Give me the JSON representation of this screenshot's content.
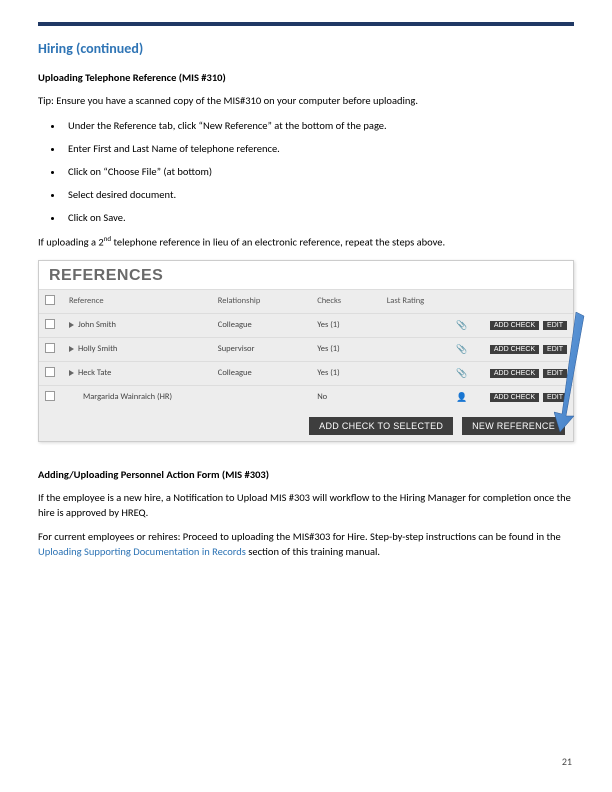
{
  "page": {
    "title": "Hiring (continued)",
    "sub1": "Uploading Telephone Reference (MIS #310)",
    "tip": "Tip: Ensure you have a scanned copy of the MIS#310 on your computer before uploading.",
    "bullets": [
      "Under the Reference tab, click “New Reference” at the bottom of the page.",
      "Enter First and Last Name of telephone reference.",
      "Click on “Choose File” (at bottom)",
      "Select desired document.",
      "Click on Save."
    ],
    "note_prefix": "If uploading a 2",
    "note_sup": "nd",
    "note_suffix": " telephone reference in lieu of an electronic reference, repeat the steps above.",
    "sub2": "Adding/Uploading Personnel Action Form (MIS #303)",
    "para2": "If the employee is a new hire, a Notification to Upload MIS #303 will workflow to the Hiring Manager for completion once the hire is approved by HREQ.",
    "para3a": "For current employees or rehires: Proceed to uploading the MIS#303 for Hire. Step-by-step instructions can be found in the ",
    "para3link": "Uploading Supporting Documentation in Records",
    "para3b": " section of this training manual.",
    "page_number": "21"
  },
  "refs": {
    "title": "REFERENCES",
    "headers": {
      "ref": "Reference",
      "rel": "Relationship",
      "checks": "Checks",
      "last": "Last Rating"
    },
    "rows": [
      {
        "name": "John Smith",
        "rel": "Colleague",
        "checks": "Yes (1)",
        "icon": "clip"
      },
      {
        "name": "Holly Smith",
        "rel": "Supervisor",
        "checks": "Yes (1)",
        "icon": "clip"
      },
      {
        "name": "Heck Tate",
        "rel": "Colleague",
        "checks": "Yes (1)",
        "icon": "clip"
      },
      {
        "name": "Margarida Wainraich (HR)",
        "rel": "",
        "checks": "No",
        "icon": "person"
      }
    ],
    "btn_add": "ADD CHECK",
    "btn_edit": "EDIT",
    "btn_footer1": "ADD CHECK TO SELECTED",
    "btn_footer2": "NEW REFERENCE"
  }
}
